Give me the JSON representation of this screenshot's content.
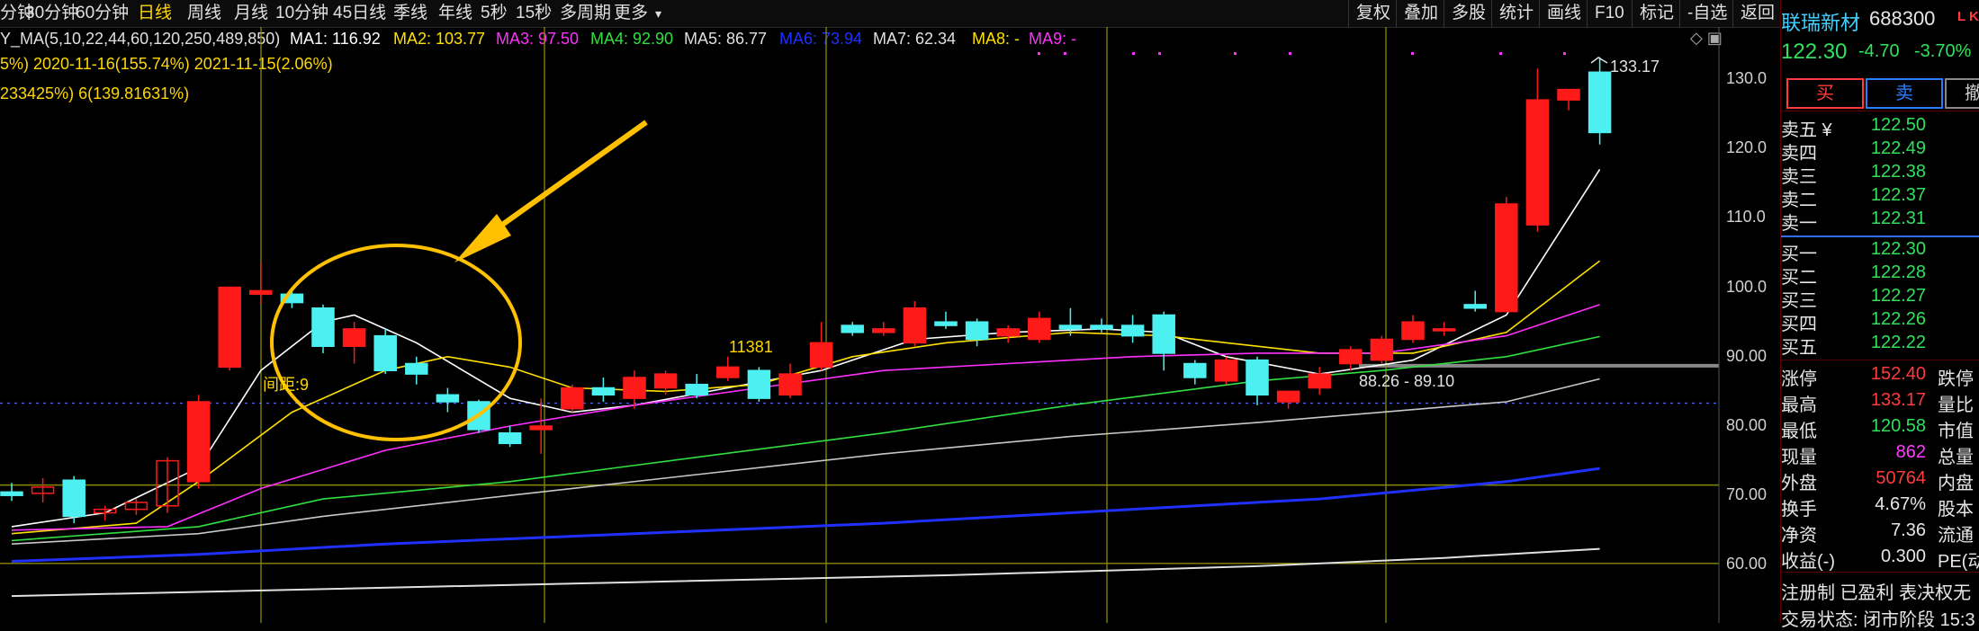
{
  "toolbar": {
    "periods": [
      "分钟",
      "30分钟",
      "60分钟",
      "日线",
      "周线",
      "月线",
      "10分钟",
      "45日线",
      "季线",
      "年线",
      "5秒",
      "15秒",
      "多周期",
      "更多"
    ],
    "active": "日线",
    "right_buttons": [
      "复权",
      "叠加",
      "多股",
      "统计",
      "画线",
      "F10",
      "标记",
      "-自选",
      "返回"
    ]
  },
  "ma_legend": {
    "prefix": "Y_MA(5,10,22,44,60,120,250,489,850)",
    "items": [
      {
        "label": "MA1: 116.92",
        "color": "#ffffff"
      },
      {
        "label": "MA2: 103.77",
        "color": "#ffe000"
      },
      {
        "label": "MA3: 97.50",
        "color": "#ff30ff"
      },
      {
        "label": "MA4: 92.90",
        "color": "#30e040"
      },
      {
        "label": "MA5: 86.77",
        "color": "#e0e0e0"
      },
      {
        "label": "MA6: 73.94",
        "color": "#2030ff"
      },
      {
        "label": "MA7: 62.34",
        "color": "#e0e0e0"
      },
      {
        "label": "MA8: -",
        "color": "#ffe000"
      },
      {
        "label": "MA9: -",
        "color": "#ff30ff"
      }
    ]
  },
  "info_line1": "5%)  2020-11-16(155.74%)  2021-11-15(2.06%)",
  "info_line2": "233425%) 6(139.81631%)",
  "annotations": {
    "peak_label": "133.17",
    "volume_label": "11381",
    "range_label": "88.26 - 89.10",
    "distance_label": "间距:9"
  },
  "colors": {
    "up": "#ff1a1a",
    "down": "#4cf0f0",
    "ma1": "#ffffff",
    "ma2": "#ffe000",
    "ma3": "#ff30ff",
    "ma4": "#30e040",
    "ma6": "#2030ff",
    "ma7": "#e0e0e0",
    "circle": "#ffc000",
    "vgrid": "#8a8a00"
  },
  "y_axis": {
    "labels": [
      "130.0",
      "120.0",
      "110.0",
      "100.0",
      "90.00",
      "80.00",
      "70.00",
      "60.00"
    ]
  },
  "stock": {
    "name": "联瑞新材",
    "code": "688300",
    "tag": "L K",
    "price": "122.30",
    "change": "-4.70",
    "change_pct": "-3.70%"
  },
  "trade_buttons": {
    "buy": "买",
    "sell": "卖",
    "cancel": "撤"
  },
  "order_book": {
    "asks": [
      {
        "label": "卖五 ¥",
        "price": "122.50"
      },
      {
        "label": "卖四",
        "price": "122.49"
      },
      {
        "label": "卖三",
        "price": "122.38"
      },
      {
        "label": "卖二",
        "price": "122.37"
      },
      {
        "label": "卖一",
        "price": "122.31"
      }
    ],
    "bids": [
      {
        "label": "买一",
        "price": "122.30"
      },
      {
        "label": "买二",
        "price": "122.28"
      },
      {
        "label": "买三",
        "price": "122.27"
      },
      {
        "label": "买四",
        "price": "122.26"
      },
      {
        "label": "买五",
        "price": "122.22"
      }
    ]
  },
  "stats": [
    {
      "label": "涨停",
      "value": "152.40",
      "cls": "red",
      "extra": "跌停"
    },
    {
      "label": "最高",
      "value": "133.17",
      "cls": "red",
      "extra": "量比"
    },
    {
      "label": "最低",
      "value": "120.58",
      "cls": "green",
      "extra": "市值"
    },
    {
      "label": "现量",
      "value": "862",
      "cls": "magenta",
      "extra": "总量"
    },
    {
      "label": "外盘",
      "value": "50764",
      "cls": "red",
      "extra": "内盘"
    },
    {
      "label": "换手",
      "value": "4.67%",
      "cls": "white",
      "extra": "股本"
    },
    {
      "label": "净资",
      "value": "7.36",
      "cls": "white",
      "extra": "流通"
    },
    {
      "label": "收益(-)",
      "value": "0.300",
      "cls": "white",
      "extra": "PE(动"
    }
  ],
  "footer": {
    "line1": "注册制  已盈利  表决权无",
    "line2": "交易状态: 闭市阶段 15:3"
  },
  "chart_data": {
    "type": "candlestick",
    "ylim": [
      55,
      135
    ],
    "candles": [
      {
        "o": 70.5,
        "h": 71.8,
        "l": 69.2,
        "c": 70.0
      },
      {
        "o": 70.3,
        "h": 72.5,
        "l": 69.0,
        "c": 71.2
      },
      {
        "o": 72.2,
        "h": 72.8,
        "l": 66.0,
        "c": 67.0
      },
      {
        "o": 67.5,
        "h": 68.5,
        "l": 66.4,
        "c": 68.0
      },
      {
        "o": 68.0,
        "h": 69.5,
        "l": 67.2,
        "c": 69.0
      },
      {
        "o": 68.5,
        "h": 75.5,
        "l": 67.5,
        "c": 75.0
      },
      {
        "o": 72.0,
        "h": 84.5,
        "l": 71.0,
        "c": 83.5
      },
      {
        "o": 88.5,
        "h": 100.0,
        "l": 88.0,
        "c": 100.0
      },
      {
        "o": 99.0,
        "h": 103.5,
        "l": 97.5,
        "c": 99.5
      },
      {
        "o": 99.0,
        "h": 99.5,
        "l": 97.0,
        "c": 97.8
      },
      {
        "o": 97.0,
        "h": 97.5,
        "l": 90.5,
        "c": 91.5
      },
      {
        "o": 91.5,
        "h": 95.0,
        "l": 89.0,
        "c": 94.0
      },
      {
        "o": 93.0,
        "h": 94.0,
        "l": 87.5,
        "c": 88.0
      },
      {
        "o": 89.0,
        "h": 90.0,
        "l": 86.0,
        "c": 87.5
      },
      {
        "o": 84.5,
        "h": 85.5,
        "l": 82.0,
        "c": 83.5
      },
      {
        "o": 83.5,
        "h": 83.8,
        "l": 79.0,
        "c": 79.5
      },
      {
        "o": 79.0,
        "h": 80.0,
        "l": 77.0,
        "c": 77.5
      },
      {
        "o": 79.5,
        "h": 84.0,
        "l": 76.0,
        "c": 80.0
      },
      {
        "o": 82.5,
        "h": 86.0,
        "l": 82.0,
        "c": 85.5
      },
      {
        "o": 85.5,
        "h": 87.0,
        "l": 83.5,
        "c": 84.5
      },
      {
        "o": 84.0,
        "h": 88.0,
        "l": 82.5,
        "c": 87.0
      },
      {
        "o": 85.5,
        "h": 88.0,
        "l": 84.5,
        "c": 87.5
      },
      {
        "o": 86.0,
        "h": 87.5,
        "l": 84.0,
        "c": 84.5
      },
      {
        "o": 87.0,
        "h": 90.0,
        "l": 86.5,
        "c": 88.5
      },
      {
        "o": 88.0,
        "h": 88.5,
        "l": 83.5,
        "c": 84.0
      },
      {
        "o": 84.5,
        "h": 89.0,
        "l": 84.0,
        "c": 87.5
      },
      {
        "o": 88.5,
        "h": 95.0,
        "l": 88.0,
        "c": 92.0
      },
      {
        "o": 94.5,
        "h": 95.0,
        "l": 93.0,
        "c": 93.5
      },
      {
        "o": 93.5,
        "h": 95.0,
        "l": 93.0,
        "c": 94.0
      },
      {
        "o": 92.0,
        "h": 98.0,
        "l": 91.5,
        "c": 97.0
      },
      {
        "o": 95.0,
        "h": 96.5,
        "l": 94.0,
        "c": 94.5
      },
      {
        "o": 95.0,
        "h": 95.5,
        "l": 91.5,
        "c": 92.5
      },
      {
        "o": 93.0,
        "h": 94.5,
        "l": 92.0,
        "c": 94.0
      },
      {
        "o": 92.5,
        "h": 96.5,
        "l": 92.0,
        "c": 95.5
      },
      {
        "o": 94.5,
        "h": 97.0,
        "l": 93.0,
        "c": 94.0
      },
      {
        "o": 94.5,
        "h": 95.5,
        "l": 93.5,
        "c": 94.0
      },
      {
        "o": 94.5,
        "h": 96.0,
        "l": 92.0,
        "c": 93.0
      },
      {
        "o": 96.0,
        "h": 96.5,
        "l": 88.0,
        "c": 90.5
      },
      {
        "o": 89.0,
        "h": 89.5,
        "l": 86.0,
        "c": 87.0
      },
      {
        "o": 86.5,
        "h": 90.0,
        "l": 86.0,
        "c": 89.5
      },
      {
        "o": 89.5,
        "h": 90.0,
        "l": 83.0,
        "c": 84.5
      },
      {
        "o": 83.5,
        "h": 85.0,
        "l": 82.5,
        "c": 85.0
      },
      {
        "o": 85.5,
        "h": 88.5,
        "l": 84.5,
        "c": 87.5
      },
      {
        "o": 89.0,
        "h": 91.5,
        "l": 88.0,
        "c": 91.0
      },
      {
        "o": 89.5,
        "h": 93.0,
        "l": 89.0,
        "c": 92.5
      },
      {
        "o": 92.5,
        "h": 96.0,
        "l": 92.0,
        "c": 95.0
      },
      {
        "o": 94.0,
        "h": 95.0,
        "l": 93.0,
        "c": 94.0
      },
      {
        "o": 97.5,
        "h": 99.5,
        "l": 96.5,
        "c": 97.0
      },
      {
        "o": 96.5,
        "h": 113.0,
        "l": 96.5,
        "c": 112.0
      },
      {
        "o": 109.0,
        "h": 131.5,
        "l": 108.0,
        "c": 127.0
      },
      {
        "o": 127.0,
        "h": 128.5,
        "l": 125.5,
        "c": 128.5
      },
      {
        "o": 131.0,
        "h": 133.17,
        "l": 120.58,
        "c": 122.3
      }
    ],
    "ma_series": [
      {
        "name": "MA1",
        "values": [
          [
            0,
            65.5
          ],
          [
            3,
            67.5
          ],
          [
            6,
            74
          ],
          [
            8,
            88
          ],
          [
            10,
            95
          ],
          [
            11,
            96
          ],
          [
            13,
            92
          ],
          [
            16,
            84
          ],
          [
            18,
            82
          ],
          [
            20,
            83
          ],
          [
            23,
            85.5
          ],
          [
            26,
            88
          ],
          [
            29,
            92.5
          ],
          [
            32,
            93.5
          ],
          [
            35,
            94
          ],
          [
            37,
            93.5
          ],
          [
            39,
            90
          ],
          [
            42,
            87.5
          ],
          [
            45,
            89.5
          ],
          [
            48,
            96
          ],
          [
            51,
            117
          ]
        ]
      },
      {
        "name": "MA2",
        "values": [
          [
            0,
            64.5
          ],
          [
            4,
            66
          ],
          [
            6,
            72
          ],
          [
            9,
            82
          ],
          [
            12,
            88
          ],
          [
            14,
            90
          ],
          [
            16,
            88.5
          ],
          [
            18,
            85.5
          ],
          [
            21,
            85
          ],
          [
            24,
            86
          ],
          [
            27,
            90
          ],
          [
            30,
            92
          ],
          [
            34,
            93.5
          ],
          [
            37,
            93
          ],
          [
            40,
            91.5
          ],
          [
            42,
            90.5
          ],
          [
            45,
            90.5
          ],
          [
            48,
            93.5
          ],
          [
            51,
            103.8
          ]
        ]
      },
      {
        "name": "MA3",
        "values": [
          [
            0,
            65
          ],
          [
            5,
            65.5
          ],
          [
            8,
            71
          ],
          [
            12,
            76.5
          ],
          [
            16,
            80
          ],
          [
            20,
            83
          ],
          [
            24,
            85.5
          ],
          [
            28,
            88
          ],
          [
            32,
            89
          ],
          [
            36,
            90
          ],
          [
            40,
            90.5
          ],
          [
            44,
            90.5
          ],
          [
            48,
            93
          ],
          [
            51,
            97.5
          ]
        ]
      },
      {
        "name": "MA4",
        "values": [
          [
            0,
            63.5
          ],
          [
            6,
            65.5
          ],
          [
            10,
            69.5
          ],
          [
            16,
            72
          ],
          [
            22,
            75.5
          ],
          [
            28,
            79
          ],
          [
            34,
            83
          ],
          [
            40,
            86.5
          ],
          [
            44,
            88
          ],
          [
            48,
            90
          ],
          [
            51,
            92.9
          ]
        ]
      },
      {
        "name": "MA5",
        "values": [
          [
            0,
            63
          ],
          [
            6,
            64.5
          ],
          [
            10,
            67
          ],
          [
            16,
            70
          ],
          [
            22,
            73
          ],
          [
            28,
            76
          ],
          [
            34,
            78.5
          ],
          [
            40,
            80.5
          ],
          [
            44,
            82
          ],
          [
            48,
            83.5
          ],
          [
            51,
            86.8
          ]
        ]
      },
      {
        "name": "MA6",
        "values": [
          [
            0,
            60.5
          ],
          [
            6,
            61.5
          ],
          [
            12,
            63
          ],
          [
            20,
            64.5
          ],
          [
            28,
            66
          ],
          [
            36,
            68
          ],
          [
            42,
            69.5
          ],
          [
            48,
            72
          ],
          [
            51,
            73.9
          ]
        ]
      },
      {
        "name": "MA7",
        "values": [
          [
            0,
            55.5
          ],
          [
            10,
            56.5
          ],
          [
            20,
            57.5
          ],
          [
            30,
            58.5
          ],
          [
            40,
            59.8
          ],
          [
            46,
            61
          ],
          [
            51,
            62.3
          ]
        ]
      }
    ]
  }
}
